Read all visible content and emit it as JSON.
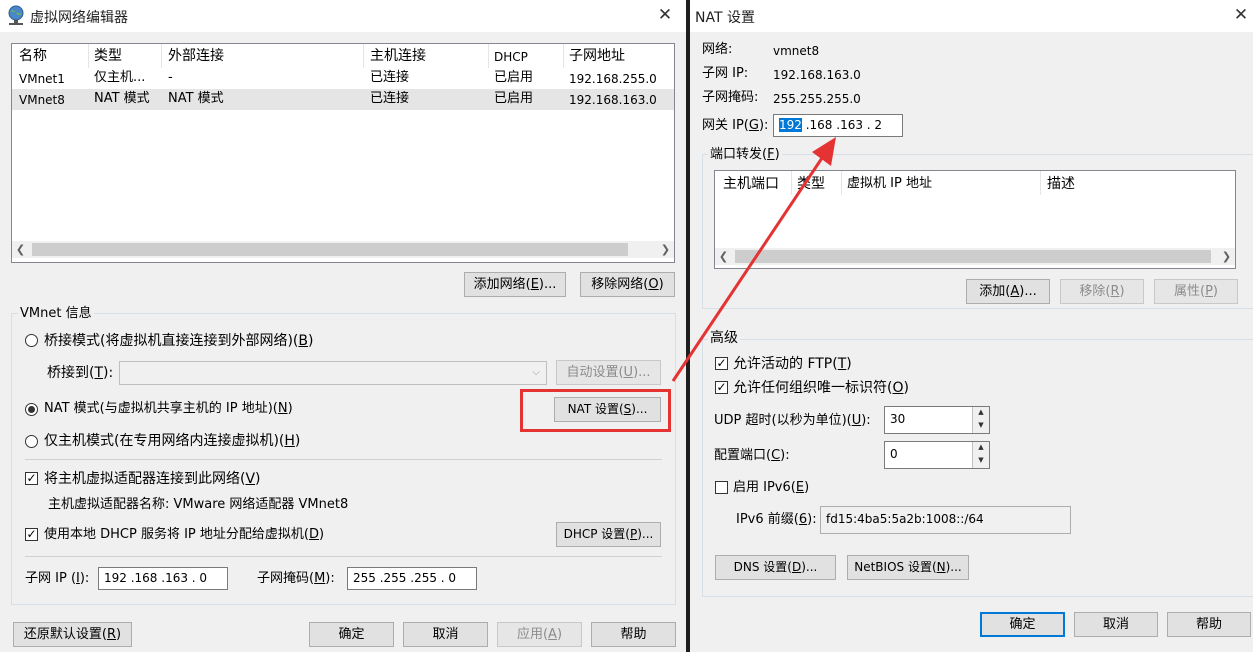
{
  "left": {
    "title": "虚拟网络编辑器",
    "table": {
      "headers": [
        "名称",
        "类型",
        "外部连接",
        "主机连接",
        "DHCP",
        "子网地址"
      ],
      "rows": [
        [
          "VMnet1",
          "仅主机...",
          "-",
          "已连接",
          "已启用",
          "192.168.255.0"
        ],
        [
          "VMnet8",
          "NAT 模式",
          "NAT 模式",
          "已连接",
          "已启用",
          "192.168.163.0"
        ]
      ]
    },
    "add_network": "添加网络(E)...",
    "remove_network": "移除网络(O)",
    "vmnet_info": "VMnet 信息",
    "bridge_mode": "桥接模式(将虚拟机直接连接到外部网络)(B)",
    "bridge_to": "桥接到(T):",
    "auto_settings": "自动设置(U)...",
    "nat_mode": "NAT 模式(与虚拟机共享主机的 IP 地址)(N)",
    "nat_settings": "NAT 设置(S)...",
    "host_only": "仅主机模式(在专用网络内连接虚拟机)(H)",
    "connect_adapter": "将主机虚拟适配器连接到此网络(V)",
    "adapter_name": "主机虚拟适配器名称: VMware 网络适配器 VMnet8",
    "use_dhcp": "使用本地 DHCP 服务将 IP 地址分配给虚拟机(D)",
    "dhcp_settings": "DHCP 设置(P)...",
    "subnet_ip_label": "子网 IP (I):",
    "subnet_ip": "192 .168 .163 .  0",
    "subnet_mask_label": "子网掩码(M):",
    "subnet_mask": "255 .255 .255 .  0",
    "restore_defaults": "还原默认设置(R)",
    "ok": "确定",
    "cancel": "取消",
    "apply": "应用(A)",
    "help": "帮助"
  },
  "right": {
    "title": "NAT 设置",
    "network_label": "网络:",
    "network_value": "vmnet8",
    "subnet_ip_label": "子网 IP:",
    "subnet_ip_value": "192.168.163.0",
    "subnet_mask_label": "子网掩码:",
    "subnet_mask_value": "255.255.255.0",
    "gateway_label": "网关 IP(G):",
    "gateway_sel": "192",
    "gateway_rest": " .168 .163 .  2",
    "port_forwarding": "端口转发(F)",
    "pf_headers": [
      "主机端口",
      "类型",
      "虚拟机 IP 地址",
      "描述"
    ],
    "add": "添加(A)...",
    "remove": "移除(R)",
    "properties": "属性(P)",
    "advanced": "高级",
    "allow_ftp": "允许活动的 FTP(T)",
    "allow_oui": "允许任何组织唯一标识符(O)",
    "udp_timeout_label": "UDP 超时(以秒为单位)(U):",
    "udp_timeout": "30",
    "config_port_label": "配置端口(C):",
    "config_port": "0",
    "enable_ipv6": "启用 IPv6(E)",
    "ipv6_prefix_label": "IPv6 前缀(6):",
    "ipv6_prefix": "fd15:4ba5:5a2b:1008::/64",
    "dns": "DNS 设置(D)...",
    "netbios": "NetBIOS 设置(N)...",
    "ok": "确定",
    "cancel": "取消",
    "help": "帮助"
  },
  "colors": {
    "highlight": "#e53333",
    "select_blue": "#0078d7"
  }
}
